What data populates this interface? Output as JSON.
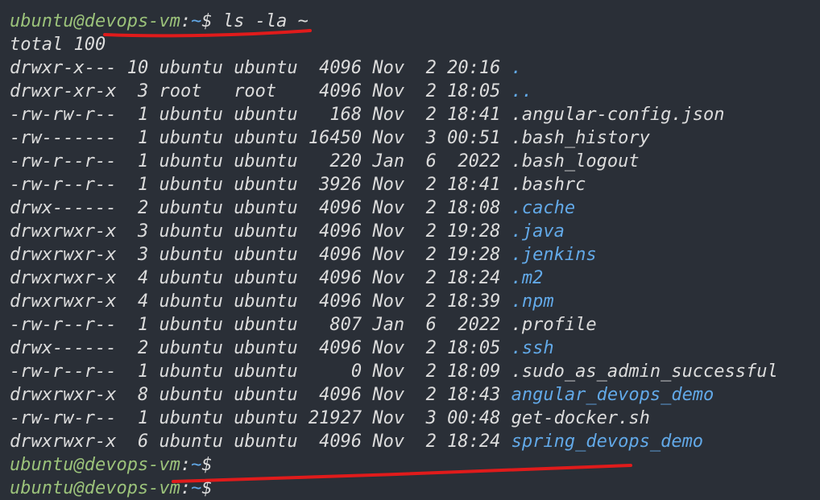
{
  "prompt": {
    "user_host": "ubuntu@devops-vm",
    "separator": ":",
    "path": "~",
    "symbol": "$"
  },
  "command": " ls -la ~",
  "total": "total 100",
  "entries": [
    {
      "perm": "drwxr-x---",
      "links": "10",
      "owner": "ubuntu",
      "group": "ubuntu",
      "size": "4096",
      "month": "Nov",
      "day": "2",
      "time": "20:16",
      "name": ".",
      "type": "dir"
    },
    {
      "perm": "drwxr-xr-x",
      "links": "3",
      "owner": "root",
      "group": "root",
      "size": "4096",
      "month": "Nov",
      "day": "2",
      "time": "18:05",
      "name": "..",
      "type": "dir"
    },
    {
      "perm": "-rw-rw-r--",
      "links": "1",
      "owner": "ubuntu",
      "group": "ubuntu",
      "size": "168",
      "month": "Nov",
      "day": "2",
      "time": "18:41",
      "name": ".angular-config.json",
      "type": "file"
    },
    {
      "perm": "-rw-------",
      "links": "1",
      "owner": "ubuntu",
      "group": "ubuntu",
      "size": "16450",
      "month": "Nov",
      "day": "3",
      "time": "00:51",
      "name": ".bash_history",
      "type": "file"
    },
    {
      "perm": "-rw-r--r--",
      "links": "1",
      "owner": "ubuntu",
      "group": "ubuntu",
      "size": "220",
      "month": "Jan",
      "day": "6",
      "time": "2022",
      "name": ".bash_logout",
      "type": "file"
    },
    {
      "perm": "-rw-r--r--",
      "links": "1",
      "owner": "ubuntu",
      "group": "ubuntu",
      "size": "3926",
      "month": "Nov",
      "day": "2",
      "time": "18:41",
      "name": ".bashrc",
      "type": "file"
    },
    {
      "perm": "drwx------",
      "links": "2",
      "owner": "ubuntu",
      "group": "ubuntu",
      "size": "4096",
      "month": "Nov",
      "day": "2",
      "time": "18:08",
      "name": ".cache",
      "type": "dir"
    },
    {
      "perm": "drwxrwxr-x",
      "links": "3",
      "owner": "ubuntu",
      "group": "ubuntu",
      "size": "4096",
      "month": "Nov",
      "day": "2",
      "time": "19:28",
      "name": ".java",
      "type": "dir"
    },
    {
      "perm": "drwxrwxr-x",
      "links": "3",
      "owner": "ubuntu",
      "group": "ubuntu",
      "size": "4096",
      "month": "Nov",
      "day": "2",
      "time": "19:28",
      "name": ".jenkins",
      "type": "dir"
    },
    {
      "perm": "drwxrwxr-x",
      "links": "4",
      "owner": "ubuntu",
      "group": "ubuntu",
      "size": "4096",
      "month": "Nov",
      "day": "2",
      "time": "18:24",
      "name": ".m2",
      "type": "dir"
    },
    {
      "perm": "drwxrwxr-x",
      "links": "4",
      "owner": "ubuntu",
      "group": "ubuntu",
      "size": "4096",
      "month": "Nov",
      "day": "2",
      "time": "18:39",
      "name": ".npm",
      "type": "dir"
    },
    {
      "perm": "-rw-r--r--",
      "links": "1",
      "owner": "ubuntu",
      "group": "ubuntu",
      "size": "807",
      "month": "Jan",
      "day": "6",
      "time": "2022",
      "name": ".profile",
      "type": "file"
    },
    {
      "perm": "drwx------",
      "links": "2",
      "owner": "ubuntu",
      "group": "ubuntu",
      "size": "4096",
      "month": "Nov",
      "day": "2",
      "time": "18:05",
      "name": ".ssh",
      "type": "dir"
    },
    {
      "perm": "-rw-r--r--",
      "links": "1",
      "owner": "ubuntu",
      "group": "ubuntu",
      "size": "0",
      "month": "Nov",
      "day": "2",
      "time": "18:09",
      "name": ".sudo_as_admin_successful",
      "type": "file"
    },
    {
      "perm": "drwxrwxr-x",
      "links": "8",
      "owner": "ubuntu",
      "group": "ubuntu",
      "size": "4096",
      "month": "Nov",
      "day": "2",
      "time": "18:43",
      "name": "angular_devops_demo",
      "type": "dir"
    },
    {
      "perm": "-rw-rw-r--",
      "links": "1",
      "owner": "ubuntu",
      "group": "ubuntu",
      "size": "21927",
      "month": "Nov",
      "day": "3",
      "time": "00:48",
      "name": "get-docker.sh",
      "type": "file"
    },
    {
      "perm": "drwxrwxr-x",
      "links": "6",
      "owner": "ubuntu",
      "group": "ubuntu",
      "size": "4096",
      "month": "Nov",
      "day": "2",
      "time": "18:24",
      "name": "spring_devops_demo",
      "type": "dir"
    }
  ],
  "colors": {
    "background": "#2a2f37",
    "prompt_user": "#9bc27a",
    "directory": "#62a9e8",
    "text": "#dcdcdc",
    "annotation": "#e01b1b"
  }
}
